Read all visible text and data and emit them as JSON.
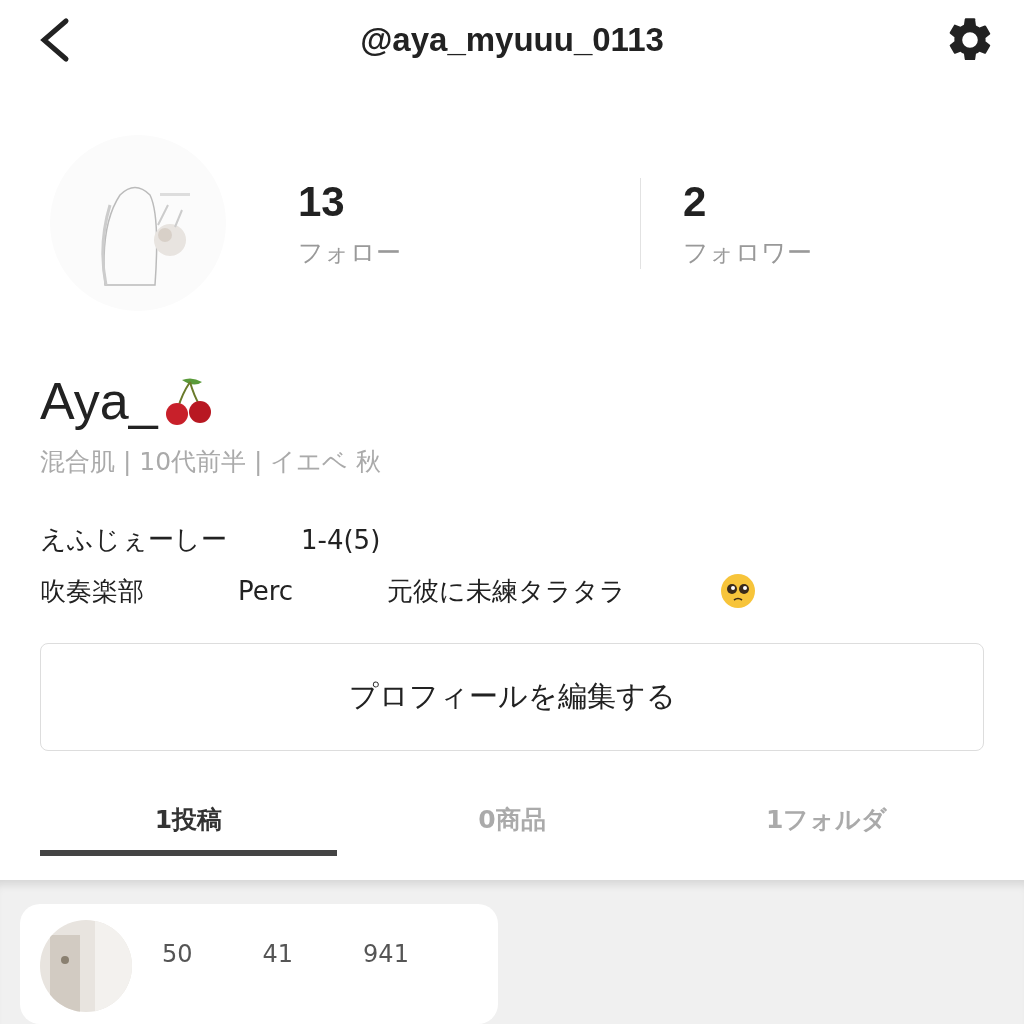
{
  "header": {
    "title": "@aya_myuuu_0113"
  },
  "profile": {
    "stats": [
      {
        "value": "13",
        "label": "フォロー"
      },
      {
        "value": "2",
        "label": "フォロワー"
      }
    ],
    "name": "Aya_",
    "tags": "混合肌 | 10代前半 | イエベ 秋",
    "bio_lines": [
      {
        "segments": [
          "えふじぇーしー",
          "1-4(5)"
        ]
      },
      {
        "segments": [
          "吹奏楽部",
          "Perc",
          "元彼に未練タラタラ"
        ]
      }
    ],
    "edit_button": "プロフィールを編集する"
  },
  "tabs": [
    {
      "label": "1投稿",
      "selected": true
    },
    {
      "label": "0商品",
      "selected": false
    },
    {
      "label": "1フォルダ",
      "selected": false
    }
  ],
  "posts": [
    {
      "counts": [
        "50",
        "41",
        "941"
      ]
    }
  ]
}
